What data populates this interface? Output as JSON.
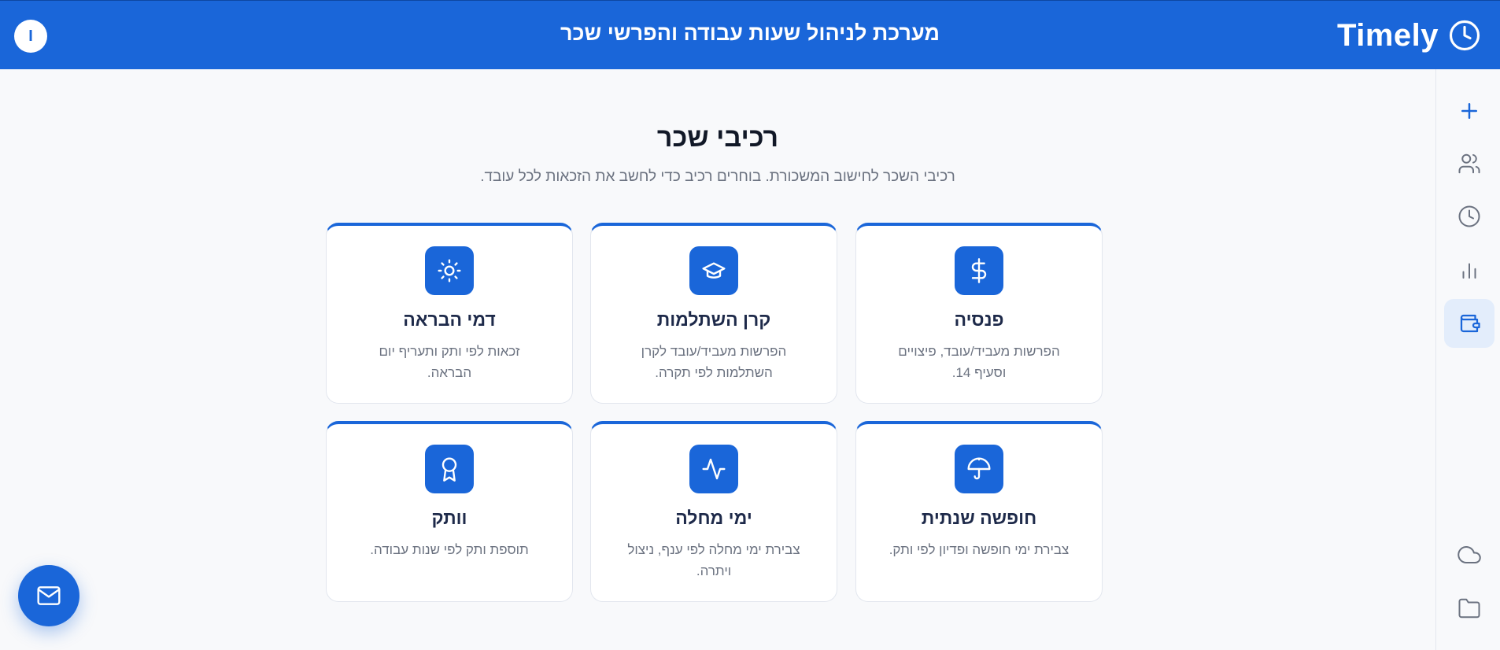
{
  "header": {
    "brand": "Timely",
    "title": "מערכת לניהול שעות עבודה והפרשי שכר",
    "user_initial": "I"
  },
  "colors": {
    "primary": "#1a66d9",
    "background": "#f8f9fb",
    "sidebar_active": "#e3edfb"
  },
  "sidebar": {
    "items": [
      {
        "icon": "plus-icon",
        "active": false
      },
      {
        "icon": "users-icon",
        "active": false
      },
      {
        "icon": "clock-icon",
        "active": false
      },
      {
        "icon": "bar-chart-icon",
        "active": false
      },
      {
        "icon": "wallet-icon",
        "active": true
      },
      {
        "icon": "cloud-icon",
        "active": false
      },
      {
        "icon": "folder-icon",
        "active": false
      }
    ]
  },
  "main": {
    "title": "רכיבי שכר",
    "subtitle": "רכיבי השכר לחישוב המשכורת. בוחרים רכיב כדי לחשב את הזכאות לכל עובד.",
    "cards": [
      {
        "icon": "dollar-icon",
        "title": "פנסיה",
        "description": "הפרשות מעביד/עובד, פיצויים וסעיף 14."
      },
      {
        "icon": "graduation-cap-icon",
        "title": "קרן השתלמות",
        "description": "הפרשות מעביד/עובד לקרן השתלמות לפי תקרה."
      },
      {
        "icon": "sun-icon",
        "title": "דמי הבראה",
        "description": "זכאות לפי ותק ותעריף יום הבראה."
      },
      {
        "icon": "umbrella-icon",
        "title": "חופשה שנתית",
        "description": "צבירת ימי חופשה ופדיון לפי ותק."
      },
      {
        "icon": "activity-icon",
        "title": "ימי מחלה",
        "description": "צבירת ימי מחלה לפי ענף, ניצול ויתרה."
      },
      {
        "icon": "award-icon",
        "title": "וותק",
        "description": "תוספת ותק לפי שנות עבודה."
      }
    ]
  },
  "fab": {
    "icon": "mail-icon"
  }
}
